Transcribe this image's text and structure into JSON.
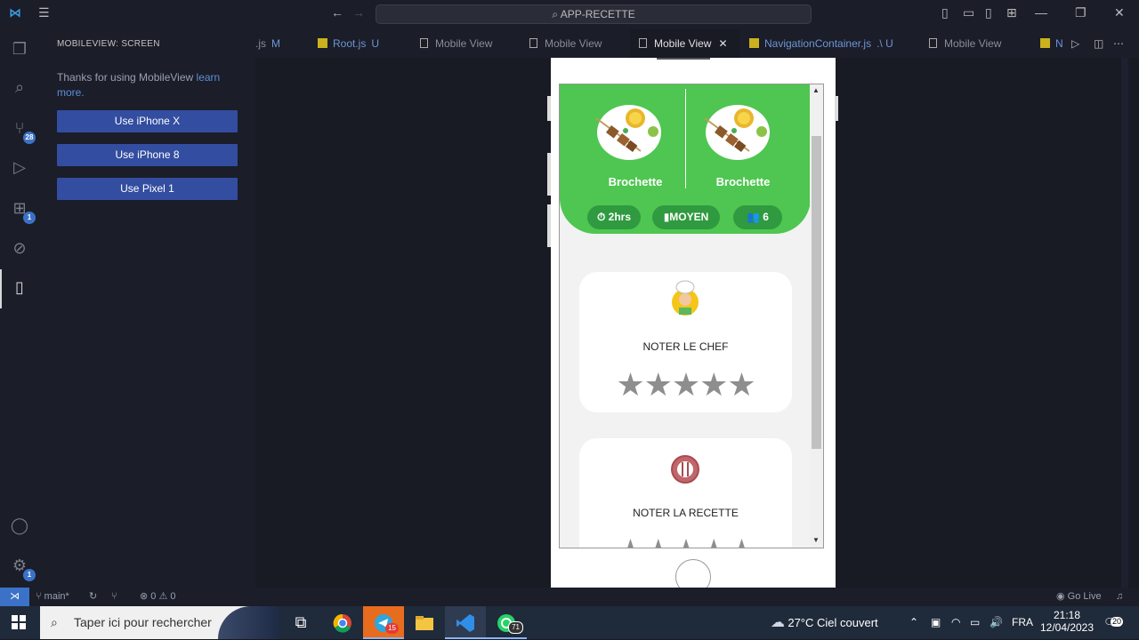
{
  "titlebar": {
    "search": "APP-RECETTE"
  },
  "sidebar": {
    "title": "MOBILEVIEW: SCREEN",
    "message": "Thanks for using MobileView",
    "link": "learn more.",
    "buttons": [
      "Use iPhone X",
      "Use iPhone 8",
      "Use Pixel 1"
    ]
  },
  "activity_badges": {
    "source_control": "28",
    "extensions": "1",
    "settings": "1"
  },
  "tabs": [
    {
      "label": ".js",
      "suffix": "M"
    },
    {
      "label": "Root.js",
      "suffix": "U"
    },
    {
      "label": "Mobile View"
    },
    {
      "label": "Mobile View"
    },
    {
      "label": "Mobile View",
      "close": "✕"
    },
    {
      "label": "NavigationContainer.js",
      "suffix": ".\\ U"
    },
    {
      "label": "Mobile View"
    },
    {
      "label": "N"
    }
  ],
  "app": {
    "dishes": [
      {
        "name": "Brochette"
      },
      {
        "name": "Brochette"
      }
    ],
    "pills": {
      "time": "2hrs",
      "level": "MOYEN",
      "people": "6"
    },
    "rate_chef": {
      "label": "NOTER LE CHEF",
      "stars": "★★★★★",
      "rating": 0
    },
    "rate_recipe": {
      "label": "NOTER LA RECETTE",
      "stars": "★★★★★",
      "rating": 0
    }
  },
  "statusbar": {
    "branch": "main*",
    "problems": "⊗ 0 ⚠ 0",
    "golive": "Go Live"
  },
  "taskbar": {
    "search": "Taper ici pour rechercher",
    "weather": "27°C  Ciel couvert",
    "lang": "FRA",
    "time": "21:18",
    "date": "12/04/2023",
    "notifications": "20",
    "telegram_badge": "15",
    "whatsapp_badge": "71"
  },
  "colors": {
    "green": "#4ec651",
    "pill": "#2f9a3f",
    "accent": "#3b72c7"
  }
}
